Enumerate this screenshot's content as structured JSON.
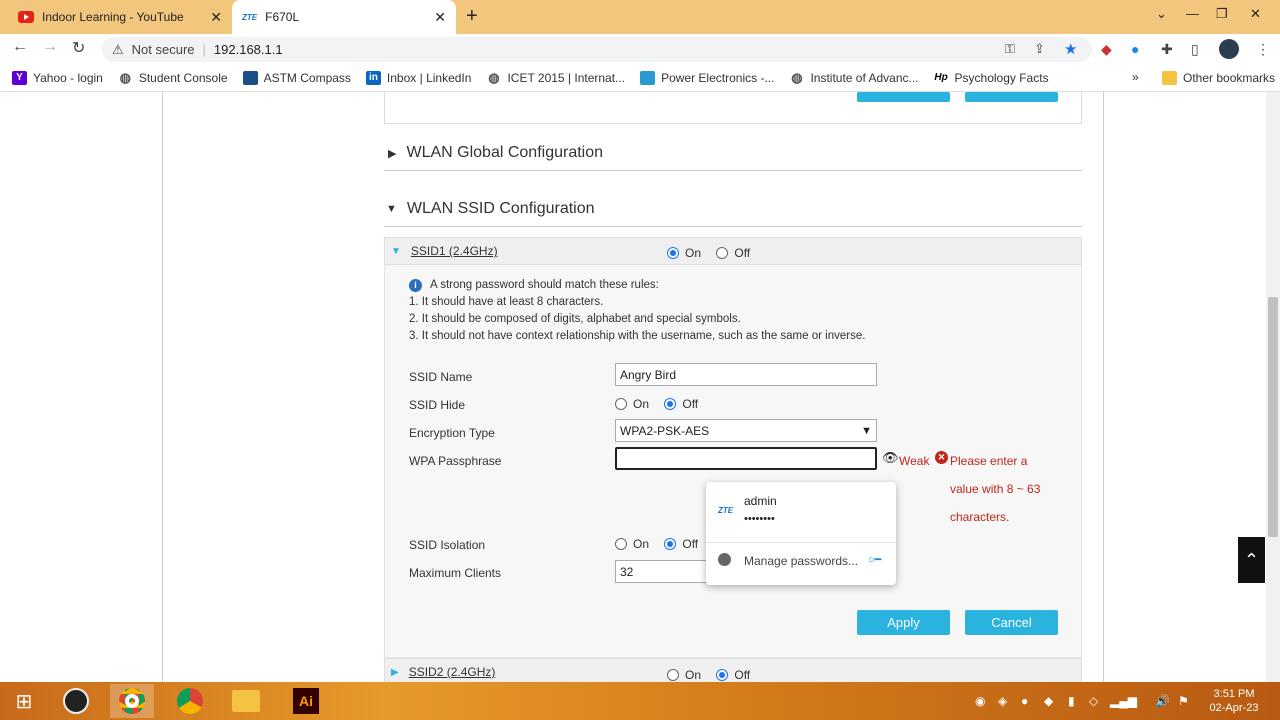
{
  "tabs": [
    {
      "title": "Indoor Learning - YouTube"
    },
    {
      "title": "F670L",
      "brand": "ZTE"
    }
  ],
  "address": {
    "security": "Not secure",
    "url": "192.168.1.1"
  },
  "bookmarks": [
    {
      "label": "Yahoo - login",
      "icon": "Y",
      "color": "#5f01d1"
    },
    {
      "label": "Student Console",
      "icon": "globe",
      "color": "#555"
    },
    {
      "label": "ASTM Compass",
      "icon": "astm",
      "color": "#1b4f8a"
    },
    {
      "label": "Inbox | LinkedIn",
      "icon": "in",
      "color": "#0a66c2"
    },
    {
      "label": "ICET 2015 | Internat...",
      "icon": "globe",
      "color": "#555"
    },
    {
      "label": "Power Electronics -...",
      "icon": "pe",
      "color": "#2a9ad3"
    },
    {
      "label": "Institute of Advanc...",
      "icon": "globe",
      "color": "#555"
    },
    {
      "label": "Psychology Facts",
      "icon": "hp",
      "color": "#000"
    }
  ],
  "bookmarks_more": "»",
  "other_bookmarks": "Other bookmarks",
  "sections": {
    "global": "WLAN Global Configuration",
    "ssid": "WLAN SSID Configuration"
  },
  "ssid1": {
    "label": "SSID1 (2.4GHz)",
    "on": "On",
    "off": "Off",
    "state": "On"
  },
  "ssid2": {
    "label": "SSID2 (2.4GHz)",
    "on": "On",
    "off": "Off",
    "state": "Off"
  },
  "rules": {
    "title": "A strong password should match these rules:",
    "r1": "1. It should have at least 8 characters.",
    "r2": "2. It should be composed of digits, alphabet and special symbols.",
    "r3": "3. It should not have context relationship with the username, such as the same or inverse."
  },
  "form": {
    "ssid_name_label": "SSID Name",
    "ssid_name_value": "Angry Bird",
    "ssid_hide_label": "SSID Hide",
    "ssid_hide_state": "Off",
    "on": "On",
    "off": "Off",
    "encryption_label": "Encryption Type",
    "encryption_value": "WPA2-PSK-AES",
    "passphrase_label": "WPA Passphrase",
    "passphrase_value": "",
    "strength": "Weak",
    "error1": "Please enter a",
    "error2": "value with 8 ~ 63",
    "error3": "characters.",
    "isolation_label": "SSID Isolation",
    "isolation_state": "Off",
    "max_clients_label": "Maximum Clients",
    "max_clients_value": "32",
    "apply": "Apply",
    "cancel": "Cancel"
  },
  "autofill": {
    "user": "admin",
    "password": "••••••••",
    "manage": "Manage passwords...",
    "brand": "ZTE"
  },
  "clock": {
    "time": "3:51 PM",
    "date": "02-Apr-23"
  }
}
